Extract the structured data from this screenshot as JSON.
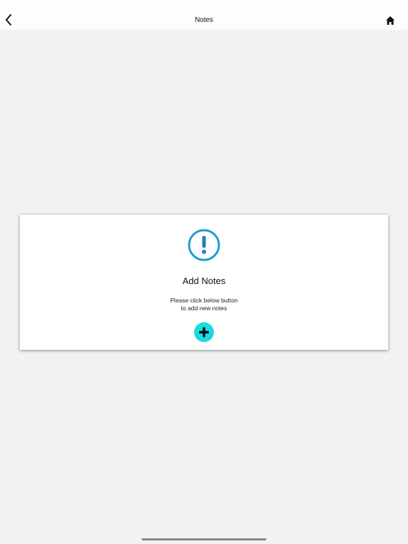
{
  "nav": {
    "title": "Notes",
    "back_icon": "chevron-left-icon",
    "home_icon": "home-icon"
  },
  "empty_state": {
    "icon": "exclamation-circle-icon",
    "icon_color": "#1f9fd1",
    "title": "Add Notes",
    "message_line1": "Please click below button",
    "message_line2": "to add new notes",
    "add_button_icon": "plus-icon",
    "add_button_color": "#1cdbe0"
  }
}
